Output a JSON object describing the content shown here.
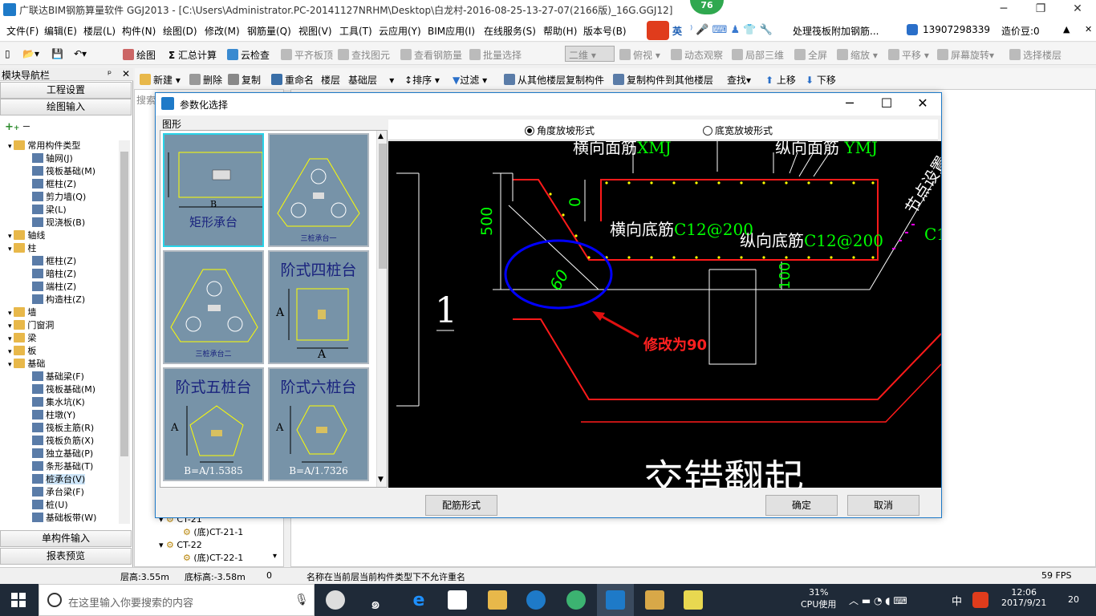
{
  "window": {
    "title": "广联达BIM钢筋算量软件 GGJ2013 - [C:\\Users\\Administrator.PC-20141127NRHM\\Desktop\\白龙村-2016-08-25-13-27-07(2166版)_16G.GGJ12]",
    "badge": "76"
  },
  "menu": [
    "文件(F)",
    "编辑(E)",
    "楼层(L)",
    "构件(N)",
    "绘图(D)",
    "修改(M)",
    "钢筋量(Q)",
    "视图(V)",
    "工具(T)",
    "云应用(Y)",
    "BIM应用(I)",
    "在线服务(S)",
    "帮助(H)",
    "版本号(B)"
  ],
  "menu_extra": {
    "notice": "处理筏板附加钢筋...",
    "phone": "13907298339",
    "beans": "造价豆:0",
    "ime": "英"
  },
  "toolbar1": [
    "绘图",
    "汇总计算",
    "云检查",
    "平齐板顶",
    "查找图元",
    "查看钢筋量",
    "批量选择",
    "二维",
    "俯视",
    "动态观察",
    "局部三维",
    "全屏",
    "缩放",
    "平移",
    "屏幕旋转",
    "选择楼层"
  ],
  "toolbar2": [
    "新建",
    "删除",
    "复制",
    "重命名",
    "楼层",
    "基础层",
    "排序",
    "过滤",
    "从其他楼层复制构件",
    "复制构件到其他楼层",
    "查找",
    "上移",
    "下移"
  ],
  "left_panel": {
    "title": "模块导航栏",
    "pin": "ᵖ",
    "buttons": [
      "工程设置",
      "绘图输入"
    ],
    "bottom_buttons": [
      "单构件输入",
      "报表预览"
    ],
    "tree": [
      {
        "label": "常用构件类型",
        "level": 1,
        "type": "folder"
      },
      {
        "label": "轴网(J)",
        "level": 2,
        "type": "comp"
      },
      {
        "label": "筏板基础(M)",
        "level": 2,
        "type": "comp"
      },
      {
        "label": "框柱(Z)",
        "level": 2,
        "type": "comp"
      },
      {
        "label": "剪力墙(Q)",
        "level": 2,
        "type": "comp"
      },
      {
        "label": "梁(L)",
        "level": 2,
        "type": "comp"
      },
      {
        "label": "现浇板(B)",
        "level": 2,
        "type": "comp"
      },
      {
        "label": "轴线",
        "level": 1,
        "type": "folder"
      },
      {
        "label": "柱",
        "level": 1,
        "type": "folder"
      },
      {
        "label": "框柱(Z)",
        "level": 2,
        "type": "comp"
      },
      {
        "label": "暗柱(Z)",
        "level": 2,
        "type": "comp"
      },
      {
        "label": "端柱(Z)",
        "level": 2,
        "type": "comp"
      },
      {
        "label": "构造柱(Z)",
        "level": 2,
        "type": "comp"
      },
      {
        "label": "墙",
        "level": 1,
        "type": "folder"
      },
      {
        "label": "门窗洞",
        "level": 1,
        "type": "folder"
      },
      {
        "label": "梁",
        "level": 1,
        "type": "folder"
      },
      {
        "label": "板",
        "level": 1,
        "type": "folder"
      },
      {
        "label": "基础",
        "level": 1,
        "type": "folder"
      },
      {
        "label": "基础梁(F)",
        "level": 2,
        "type": "comp"
      },
      {
        "label": "筏板基础(M)",
        "level": 2,
        "type": "comp"
      },
      {
        "label": "集水坑(K)",
        "level": 2,
        "type": "comp"
      },
      {
        "label": "柱墩(Y)",
        "level": 2,
        "type": "comp"
      },
      {
        "label": "筏板主筋(R)",
        "level": 2,
        "type": "comp"
      },
      {
        "label": "筏板负筋(X)",
        "level": 2,
        "type": "comp"
      },
      {
        "label": "独立基础(P)",
        "level": 2,
        "type": "comp"
      },
      {
        "label": "条形基础(T)",
        "level": 2,
        "type": "comp"
      },
      {
        "label": "桩承台(V)",
        "level": 2,
        "type": "comp"
      },
      {
        "label": "承台梁(F)",
        "level": 2,
        "type": "comp"
      },
      {
        "label": "桩(U)",
        "level": 2,
        "type": "comp"
      },
      {
        "label": "基础板带(W)",
        "level": 2,
        "type": "comp"
      }
    ]
  },
  "mid_panel": {
    "search": "搜索",
    "items": [
      "CT-21",
      "(底)CT-21-1",
      "CT-22",
      "(底)CT-22-1"
    ]
  },
  "dialog": {
    "title": "参数化选择",
    "shapes_label": "图形",
    "tiles": [
      {
        "label": "矩形承台",
        "sub": "B"
      },
      {
        "label": "三桩承台一",
        "sub": ""
      },
      {
        "label": "三桩承台二",
        "sub": ""
      },
      {
        "label": "阶式四桩台",
        "sub": "A"
      },
      {
        "label": "阶式五桩台",
        "sub": "B=A/1.5385"
      },
      {
        "label": "阶式六桩台",
        "sub": "B=A/1.7326"
      }
    ],
    "radio_options": [
      {
        "label": "角度放坡形式",
        "checked": true
      },
      {
        "label": "底宽放坡形式",
        "checked": false
      }
    ],
    "drawing": {
      "top_labels": [
        "横向面筋",
        "XMJ",
        "纵向面筋",
        "YMJ"
      ],
      "side_text": "节点设置",
      "dim_500": "500",
      "dim_0": "0",
      "dim_60": "60",
      "dim_100": "100",
      "heng_label": "横向底筋",
      "heng_value": "C12@200",
      "zong_label": "纵向底筋",
      "zong_value": "C12@200",
      "right_c": "C1",
      "num_1": "1",
      "annotation": "修改为90",
      "big_text": "交错翻起"
    },
    "buttons": {
      "rebar_form": "配筋形式",
      "ok": "确定",
      "cancel": "取消"
    }
  },
  "status": {
    "floor_height": "层高:3.55m",
    "base_elev": "底标高:-3.58m",
    "zero": "0",
    "message": "名称在当前层当前构件类型下不允许重名",
    "fps": "59 FPS"
  },
  "taskbar": {
    "search_placeholder": "在这里输入你要搜索的内容",
    "cpu_pct": "31%",
    "cpu_label": "CPU使用",
    "lang": "中",
    "time": "12:06",
    "date": "2017/9/21",
    "notif": "20"
  },
  "colors": {
    "accent": "#1e7ac8",
    "rebar_red": "#ff1a1a",
    "rebar_green": "#00ff00",
    "annotation_blue": "#0000ff",
    "tile_bg": "#7793a8",
    "tile_selected": "#29d3e8"
  }
}
